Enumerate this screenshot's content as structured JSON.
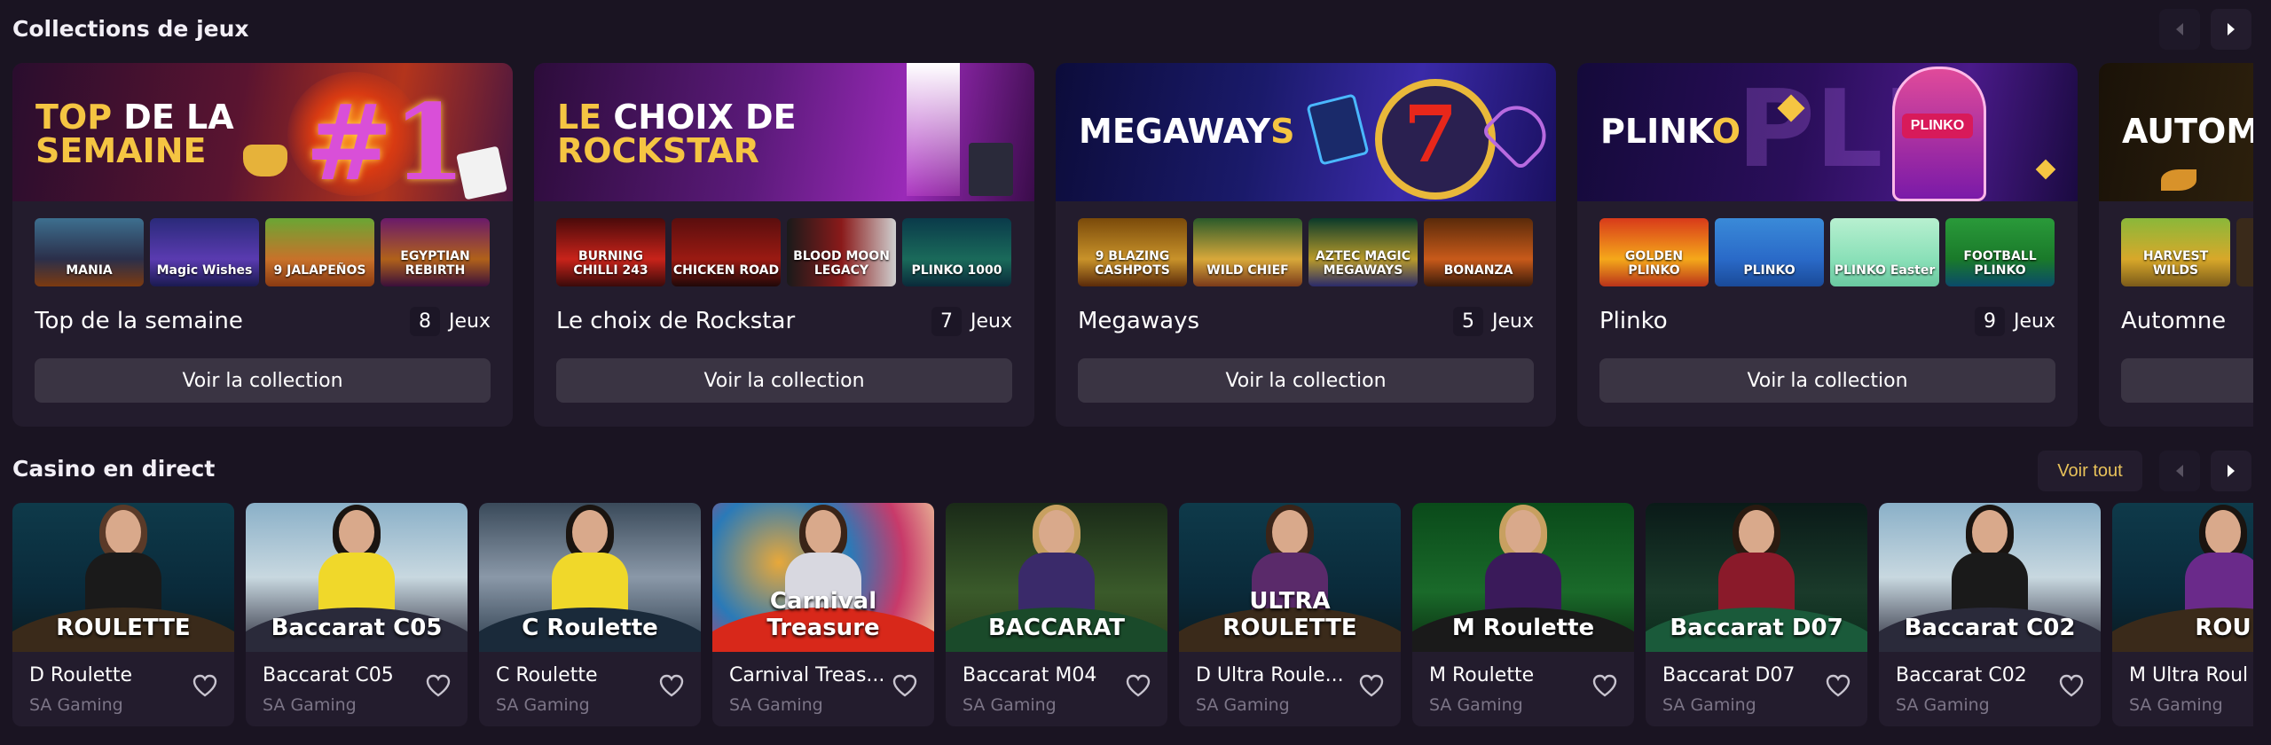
{
  "collections": {
    "title": "Collections de jeux",
    "button_label": "Voir la collection",
    "count_suffix": "Jeux",
    "items": [
      {
        "banner_hl": "TOP",
        "banner_rest_1": " DE LA",
        "banner_line2": "SEMAINE",
        "banner_art": "#1",
        "name": "Top de la semaine",
        "count": "8",
        "thumbs": [
          "MANIA",
          "Magic Wishes",
          "9 JALAPEÑOS",
          "EGYPTIAN REBIRTH"
        ]
      },
      {
        "banner_hl": "LE",
        "banner_rest_1": " CHOIX DE",
        "banner_line2": "ROCKSTAR",
        "banner_art": "",
        "name": "Le choix de Rockstar",
        "count": "7",
        "thumbs": [
          "BURNING CHILLI 243",
          "CHICKEN ROAD",
          "BLOOD MOON LEGACY",
          "PLINKO 1000"
        ]
      },
      {
        "banner_hl": "",
        "banner_rest_1": "MEGAWAY",
        "banner_hl2": "S",
        "banner_line2": "",
        "banner_art": "7",
        "name": "Megaways",
        "count": "5",
        "thumbs": [
          "9 BLAZING CASHPOTS",
          "WILD CHIEF",
          "AZTEC MAGIC MEGAWAYS",
          "BONANZA"
        ]
      },
      {
        "banner_hl": "",
        "banner_rest_1": "PLINK",
        "banner_hl2": "O",
        "banner_line2": "",
        "banner_art": "PLINKO",
        "name": "Plinko",
        "count": "9",
        "thumbs": [
          "GOLDEN PLINKO",
          "PLINKO",
          "PLINKO Easter",
          "FOOTBALL PLINKO"
        ]
      },
      {
        "banner_hl": "",
        "banner_rest_1": "AUTOM",
        "banner_hl2": "",
        "banner_line2": "",
        "banner_art": "",
        "name": "Automne",
        "count": "",
        "thumbs": [
          "HARVEST WILDS"
        ]
      }
    ]
  },
  "live": {
    "title": "Casino en direct",
    "see_all": "Voir tout",
    "items": [
      {
        "name": "D Roulette",
        "provider": "SA Gaming",
        "logo": "ROULETTE"
      },
      {
        "name": "Baccarat C05",
        "provider": "SA Gaming",
        "logo": "Baccarat C05"
      },
      {
        "name": "C Roulette",
        "provider": "SA Gaming",
        "logo": "C Roulette"
      },
      {
        "name": "Carnival Treas...",
        "provider": "SA Gaming",
        "logo": "Carnival Treasure"
      },
      {
        "name": "Baccarat M04",
        "provider": "SA Gaming",
        "logo": "BACCARAT"
      },
      {
        "name": "D Ultra Roule...",
        "provider": "SA Gaming",
        "logo": "ULTRA ROULETTE"
      },
      {
        "name": "M Roulette",
        "provider": "SA Gaming",
        "logo": "M Roulette"
      },
      {
        "name": "Baccarat D07",
        "provider": "SA Gaming",
        "logo": "Baccarat D07"
      },
      {
        "name": "Baccarat C02",
        "provider": "SA Gaming",
        "logo": "Baccarat C02"
      },
      {
        "name": "M Ultra Roul",
        "provider": "SA Gaming",
        "logo": "ROU"
      }
    ]
  },
  "colors": {
    "accent": "#f5c542",
    "bg": "#1a1422",
    "card": "#231c2d"
  }
}
